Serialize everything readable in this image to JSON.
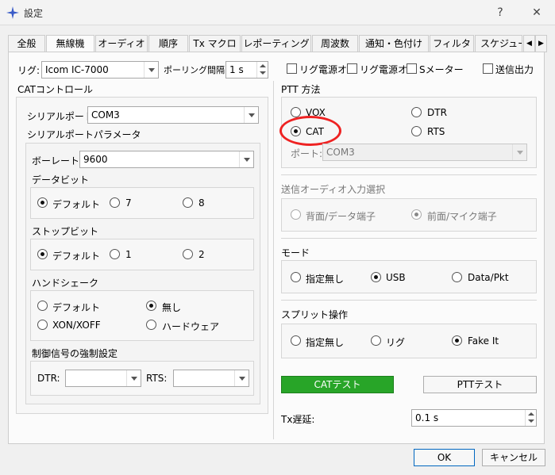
{
  "window": {
    "title": "設定",
    "help_glyph": "?",
    "close_glyph": "✕"
  },
  "tabs": [
    {
      "label": "全般"
    },
    {
      "label": "無線機",
      "active": true
    },
    {
      "label": "オーディオ"
    },
    {
      "label": "順序"
    },
    {
      "label": "Tx マクロ"
    },
    {
      "label": "レポーティング"
    },
    {
      "label": "周波数"
    },
    {
      "label": "通知・色付け"
    },
    {
      "label": "フィルタ"
    },
    {
      "label": "スケジューラ"
    }
  ],
  "top_row": {
    "rig_label": "リグ:",
    "rig_value": "Icom IC-7000",
    "polling_label": "ポーリング間隔:",
    "polling_value": "1 s",
    "cb1": "リグ電源オ",
    "cb2": "リグ電源オ",
    "cb3": "Sメーター",
    "cb4": "送信出力"
  },
  "cat": {
    "title": "CATコントロール",
    "serial_port_label": "シリアルポート:",
    "serial_port_value": "COM3",
    "serial_params_title": "シリアルポートパラメータ",
    "baud_label": "ボーレート:",
    "baud_value": "9600",
    "data_bits_title": "データビット",
    "data_bits": [
      "デフォルト",
      "7",
      "8"
    ],
    "stop_bits_title": "ストップビット",
    "stop_bits": [
      "デフォルト",
      "1",
      "2"
    ],
    "handshake_title": "ハンドシェーク",
    "handshake": [
      "デフォルト",
      "無し",
      "XON/XOFF",
      "ハードウェア"
    ],
    "force_title": "制御信号の強制設定",
    "dtr_label": "DTR:",
    "rts_label": "RTS:"
  },
  "ptt": {
    "title": "PTT 方法",
    "vox": "VOX",
    "dtr": "DTR",
    "cat": "CAT",
    "rts": "RTS",
    "port_label": "ポート:",
    "port_value": "COM3"
  },
  "audio": {
    "title": "送信オーディオ入力選択",
    "rear": "背面/データ端子",
    "front": "前面/マイク端子"
  },
  "mode": {
    "title": "モード",
    "none": "指定無し",
    "usb": "USB",
    "data": "Data/Pkt"
  },
  "split": {
    "title": "スプリット操作",
    "none": "指定無し",
    "rig": "リグ",
    "fake": "Fake It"
  },
  "buttons": {
    "cat_test": "CATテスト",
    "ptt_test": "PTTテスト",
    "ok": "OK",
    "cancel": "キャンセル"
  },
  "tx_delay": {
    "label": "Tx遅延:",
    "value": "0.1 s"
  }
}
